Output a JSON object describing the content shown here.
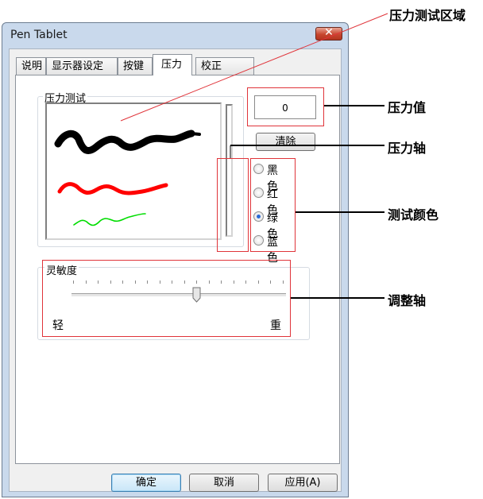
{
  "window": {
    "title": "Pen Tablet"
  },
  "tabs": [
    {
      "label": "说明"
    },
    {
      "label": "显示器设定"
    },
    {
      "label": "按键"
    },
    {
      "label": "压力",
      "active": true
    },
    {
      "label": "校正"
    }
  ],
  "pressure_test": {
    "group_label": "压力测试",
    "value": "0",
    "clear_button": "清除",
    "stroke_colors": [
      "#000000",
      "#ff0000",
      "#00dd00"
    ]
  },
  "colors": {
    "options": [
      "黑色",
      "红色",
      "绿色",
      "蓝色"
    ],
    "selected": "绿色"
  },
  "sensitivity": {
    "label": "灵敏度",
    "min_label": "轻",
    "max_label": "重",
    "level": 0.58
  },
  "footer": {
    "ok": "确定",
    "cancel": "取消",
    "apply": "应用(A)"
  },
  "annotations": {
    "area": "压力测试区域",
    "value": "压力值",
    "axis": "压力轴",
    "color": "测试颜色",
    "slider": "调整轴"
  }
}
